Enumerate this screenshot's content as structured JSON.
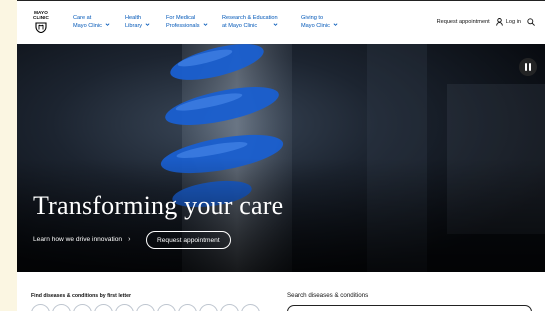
{
  "logo": {
    "line1": "MAYO",
    "line2": "CLINIC"
  },
  "nav": [
    {
      "line1": "Care at",
      "line2": "Mayo Clinic"
    },
    {
      "line1": "Health",
      "line2": "Library"
    },
    {
      "line1": "For Medical",
      "line2": "Professionals"
    },
    {
      "line1": "Research & Education",
      "line2": "at Mayo Clinic"
    },
    {
      "line1": "Giving to",
      "line2": "Mayo Clinic"
    }
  ],
  "utility": {
    "request_appointment": "Request appointment",
    "login": "Log in"
  },
  "hero": {
    "title": "Transforming your care",
    "link_text": "Learn how we drive innovation",
    "link_arrow": "›",
    "cta": "Request appointment"
  },
  "diseases": {
    "find_label": "Find diseases & conditions by first letter",
    "search_label": "Search diseases & conditions"
  },
  "colors": {
    "nav_link": "#0057b8",
    "hero_bg": "#0c1118",
    "page_margin": "#fbf6e2"
  }
}
